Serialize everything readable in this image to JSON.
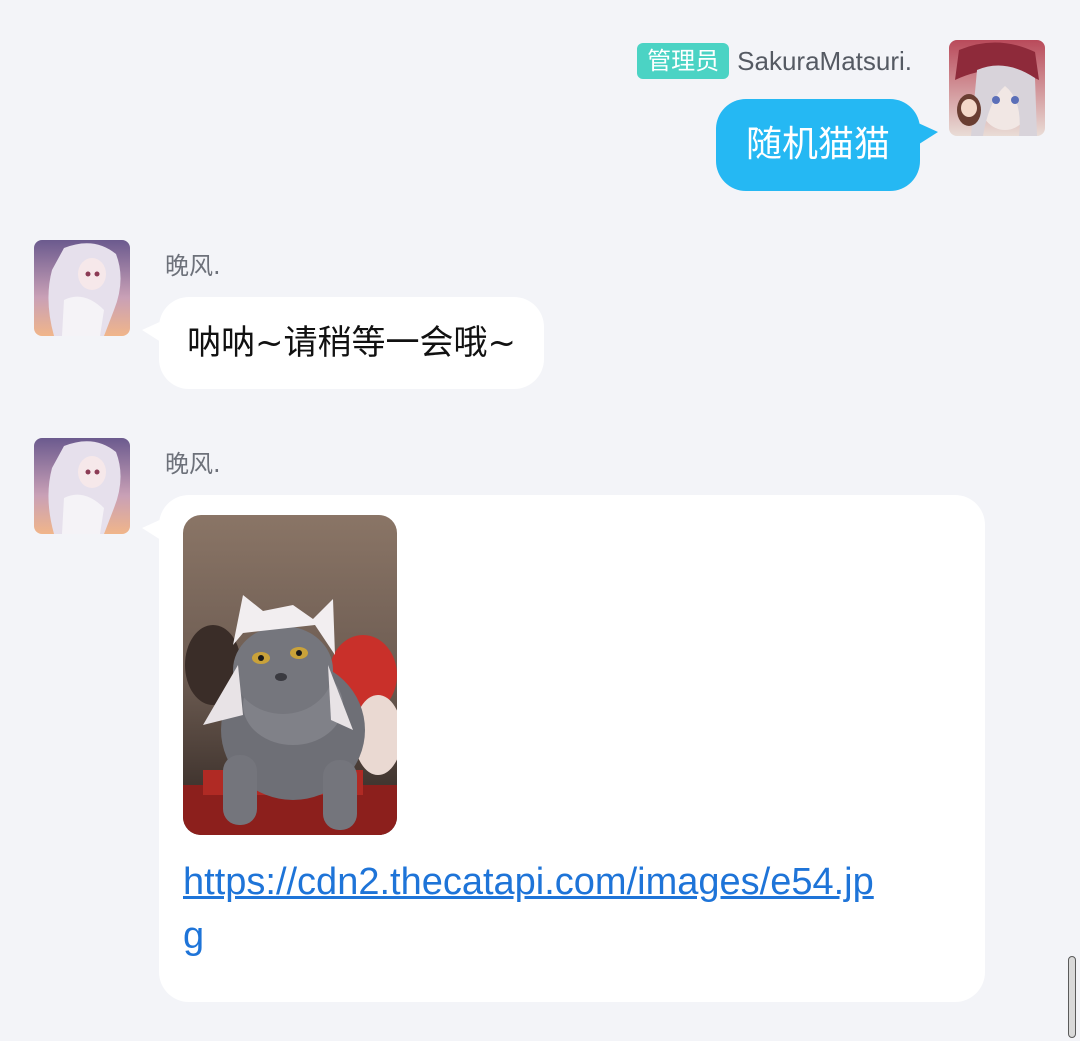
{
  "messages": [
    {
      "direction": "outgoing",
      "badge": "管理员",
      "sender": "SakuraMatsuri.",
      "text": "随机猫猫"
    },
    {
      "direction": "incoming",
      "sender": "晚风.",
      "text": "呐呐~请稍等一会哦~"
    },
    {
      "direction": "incoming",
      "sender": "晚风.",
      "image": "cat-photo",
      "link": "https://cdn2.thecatapi.com/images/e54.jpg"
    }
  ],
  "colors": {
    "background": "#f3f4f8",
    "outgoing_bubble": "#25b8f3",
    "incoming_bubble": "#ffffff",
    "badge": "#4bd3c4",
    "link": "#1e74d8"
  }
}
